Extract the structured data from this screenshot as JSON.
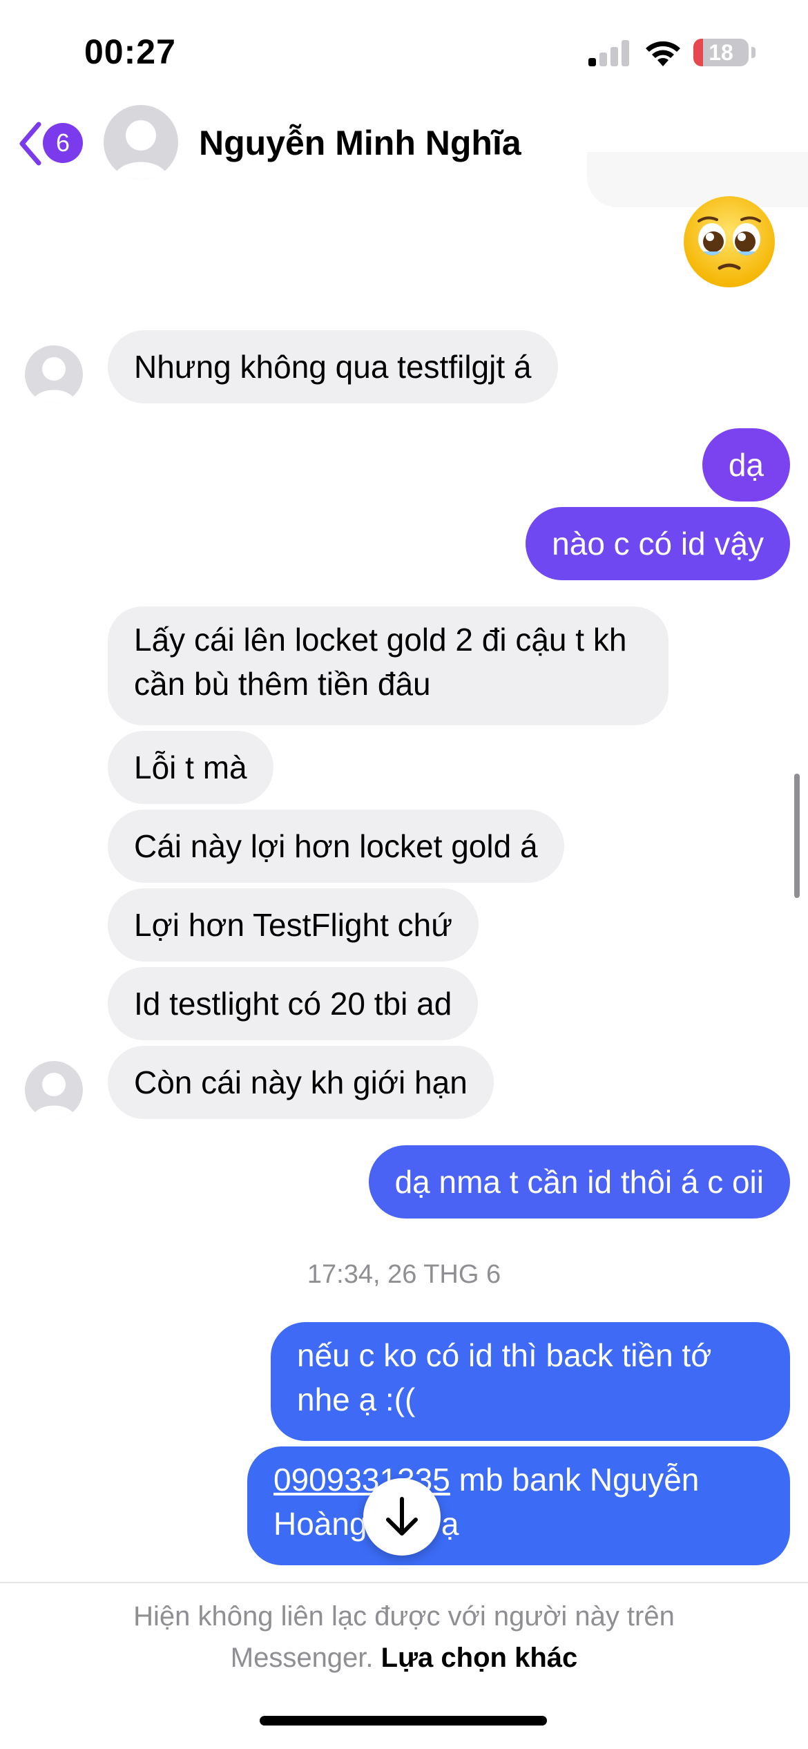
{
  "status": {
    "time": "00:27",
    "battery": "18",
    "battery_level": 0.18
  },
  "header": {
    "unread_count": "6",
    "contact_name": "Nguyễn Minh Nghĩa"
  },
  "colors": {
    "accent": "#7c3aed",
    "outgoing_top": "#7b43f0",
    "outgoing_bottom": "#3c6cf6",
    "incoming": "#efeff1"
  },
  "messages": {
    "m1": "Nhưng không qua testfilgjt á",
    "m2": "dạ",
    "m3": "nào c có id vậy",
    "m4": "Lấy cái lên locket gold 2 đi cậu t kh cần bù thêm tiền đâu",
    "m5": "Lỗi t mà",
    "m6": "Cái này lợi hơn locket gold á",
    "m7": "Lợi hơn TestFlight chứ",
    "m8": "Id testlight có 20 tbi ad",
    "m9": "Còn cái này kh giới hạn",
    "m10": "dạ nma t cần id thôi á c oii",
    "timestamp": "17:34, 26 THG 6",
    "m11": "nếu c ko có id thì back tiền tớ nhe ạ :((",
    "m12_phone": "0909331335",
    "m12_rest": " mb bank Nguyễn Hoàng Duy ạ"
  },
  "footer": {
    "notice": "Hiện không liên lạc được với người này trên Messenger.",
    "link": "Lựa chọn khác"
  },
  "icons": {
    "back": "chevron-left-icon",
    "reaction": "pleading-face-emoji",
    "scroll": "arrow-down-icon"
  }
}
